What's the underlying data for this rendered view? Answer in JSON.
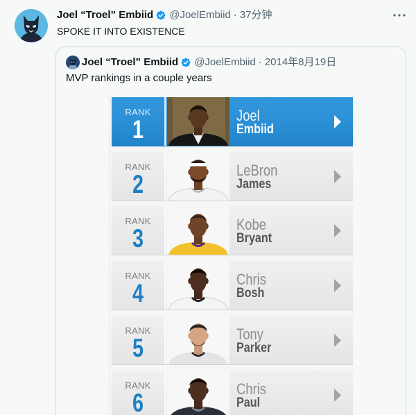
{
  "tweet": {
    "author_name": "Joel “Troel” Embiid",
    "handle": "@JoelEmbiid",
    "separator": "·",
    "time": "37分钟",
    "verified": true,
    "text": "SPOKE IT INTO EXISTENCE"
  },
  "quoted_tweet": {
    "author_name": "Joel “Troel” Embiid",
    "handle": "@JoelEmbiid",
    "separator": "·",
    "date": "2014年8月19日",
    "verified": true,
    "text": "MVP rankings in a couple years",
    "image": {
      "rank_label": "RANK",
      "rankings": [
        {
          "rank": "1",
          "first_name": "Joel",
          "last_name": "Embiid",
          "highlighted": true
        },
        {
          "rank": "2",
          "first_name": "LeBron",
          "last_name": "James",
          "highlighted": false
        },
        {
          "rank": "3",
          "first_name": "Kobe",
          "last_name": "Bryant",
          "highlighted": false
        },
        {
          "rank": "4",
          "first_name": "Chris",
          "last_name": "Bosh",
          "highlighted": false
        },
        {
          "rank": "5",
          "first_name": "Tony",
          "last_name": "Parker",
          "highlighted": false
        },
        {
          "rank": "6",
          "first_name": "Chris",
          "last_name": "Paul",
          "highlighted": false
        }
      ]
    }
  },
  "icons": {
    "author_avatar": "wolf-avatar",
    "verified": "verified-badge-icon",
    "more": "more-icon",
    "row_arrow": "chevron-right-icon"
  },
  "colors": {
    "primary_text": "#0f1419",
    "secondary_text": "#536471",
    "verified_badge": "#1d9bf0",
    "border": "#cfd9de",
    "highlight_row": "#2a8fd5",
    "rank_number": "#1f7fc5"
  }
}
